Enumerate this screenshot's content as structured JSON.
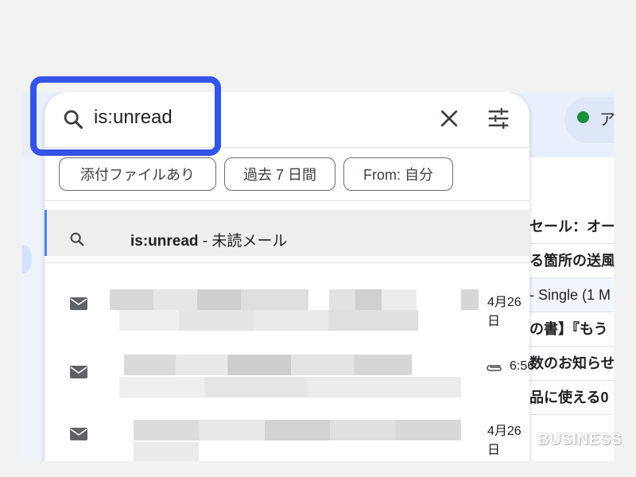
{
  "search": {
    "query": "is:unread",
    "clear_icon": "close-icon",
    "options_icon": "tune-icon"
  },
  "chips": [
    "添付ファイルあり",
    "過去 7 日間",
    "From: 自分"
  ],
  "suggestion": {
    "operator": "is:unread",
    "description": " - 未読メール"
  },
  "results": [
    {
      "time": "4月26日",
      "has_attachment": false
    },
    {
      "time": "6:56",
      "has_attachment": true
    },
    {
      "time": "4月26日",
      "has_attachment": false
    }
  ],
  "background": {
    "status_label": "ア",
    "rows": [
      "セール：オー",
      "る箇所の送風",
      "- Single (1 M",
      "の書】『もう",
      "数のお知らせ",
      "品に使える0"
    ]
  },
  "watermark": "BUSINESS",
  "colors": {
    "highlight": "#3354e6",
    "status_dot": "#1e8e3e",
    "suggestion_bar": "#4a86e8"
  }
}
